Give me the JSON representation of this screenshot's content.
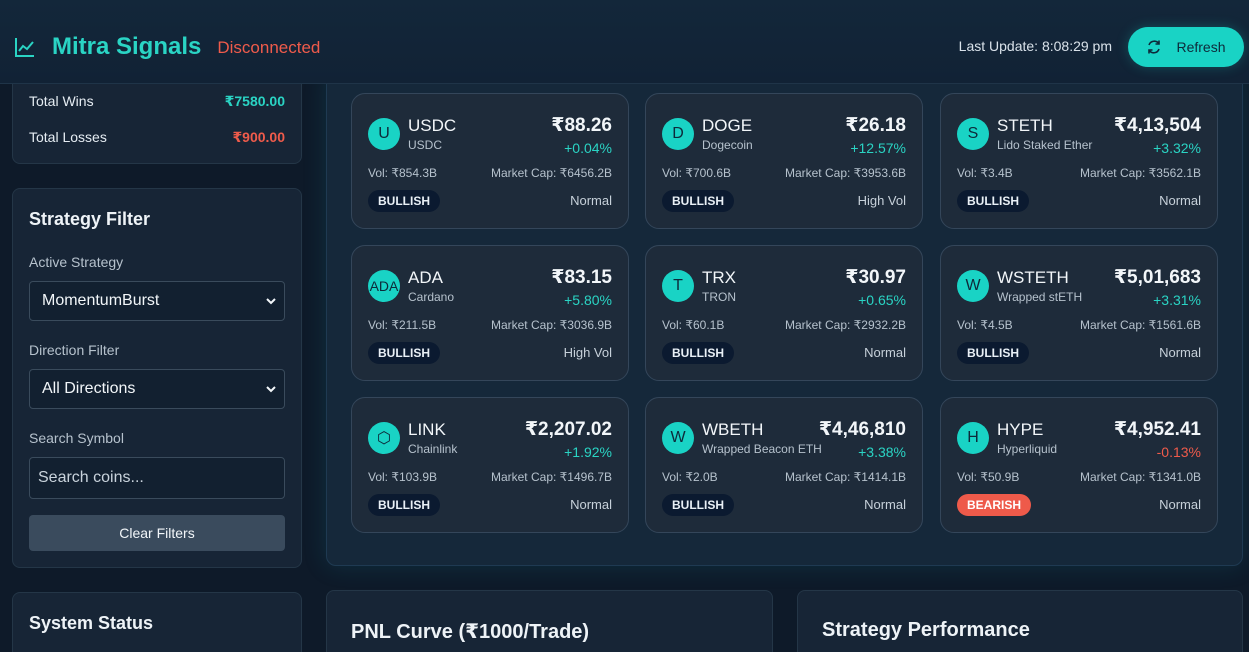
{
  "header": {
    "brand": "Mitra Signals",
    "connection_status": "Disconnected",
    "last_update": "Last Update: 8:08:29 pm",
    "refresh_label": "Refresh"
  },
  "stats": {
    "wins_label": "Total Wins",
    "wins_value": "₹7580.00",
    "losses_label": "Total Losses",
    "losses_value": "₹900.00"
  },
  "filter": {
    "title": "Strategy Filter",
    "strategy_label": "Active Strategy",
    "strategy_value": "MomentumBurst",
    "direction_label": "Direction Filter",
    "direction_value": "All Directions",
    "search_label": "Search Symbol",
    "search_placeholder": "Search coins...",
    "clear_label": "Clear Filters"
  },
  "system": {
    "title": "System Status"
  },
  "coins": [
    {
      "icon": "U",
      "symbol": "USDC",
      "name": "USDC",
      "price": "₹88.26",
      "change": "+0.04%",
      "dir": "up",
      "vol": "Vol: ₹854.3B",
      "mcap": "Market Cap: ₹6456.2B",
      "signal": "BULLISH",
      "volatility": "Normal"
    },
    {
      "icon": "D",
      "symbol": "DOGE",
      "name": "Dogecoin",
      "price": "₹26.18",
      "change": "+12.57%",
      "dir": "up",
      "vol": "Vol: ₹700.6B",
      "mcap": "Market Cap: ₹3953.6B",
      "signal": "BULLISH",
      "volatility": "High Vol"
    },
    {
      "icon": "S",
      "symbol": "STETH",
      "name": "Lido Staked Ether",
      "price": "₹4,13,504",
      "change": "+3.32%",
      "dir": "up",
      "vol": "Vol: ₹3.4B",
      "mcap": "Market Cap: ₹3562.1B",
      "signal": "BULLISH",
      "volatility": "Normal"
    },
    {
      "icon": "ADA",
      "symbol": "ADA",
      "name": "Cardano",
      "price": "₹83.15",
      "change": "+5.80%",
      "dir": "up",
      "vol": "Vol: ₹211.5B",
      "mcap": "Market Cap: ₹3036.9B",
      "signal": "BULLISH",
      "volatility": "High Vol"
    },
    {
      "icon": "T",
      "symbol": "TRX",
      "name": "TRON",
      "price": "₹30.97",
      "change": "+0.65%",
      "dir": "up",
      "vol": "Vol: ₹60.1B",
      "mcap": "Market Cap: ₹2932.2B",
      "signal": "BULLISH",
      "volatility": "Normal"
    },
    {
      "icon": "W",
      "symbol": "WSTETH",
      "name": "Wrapped stETH",
      "price": "₹5,01,683",
      "change": "+3.31%",
      "dir": "up",
      "vol": "Vol: ₹4.5B",
      "mcap": "Market Cap: ₹1561.6B",
      "signal": "BULLISH",
      "volatility": "Normal"
    },
    {
      "icon": "⬡",
      "symbol": "LINK",
      "name": "Chainlink",
      "price": "₹2,207.02",
      "change": "+1.92%",
      "dir": "up",
      "vol": "Vol: ₹103.9B",
      "mcap": "Market Cap: ₹1496.7B",
      "signal": "BULLISH",
      "volatility": "Normal"
    },
    {
      "icon": "W",
      "symbol": "WBETH",
      "name": "Wrapped Beacon ETH",
      "price": "₹4,46,810",
      "change": "+3.38%",
      "dir": "up",
      "vol": "Vol: ₹2.0B",
      "mcap": "Market Cap: ₹1414.1B",
      "signal": "BULLISH",
      "volatility": "Normal"
    },
    {
      "icon": "H",
      "symbol": "HYPE",
      "name": "Hyperliquid",
      "price": "₹4,952.41",
      "change": "-0.13%",
      "dir": "down",
      "vol": "Vol: ₹50.9B",
      "mcap": "Market Cap: ₹1341.0B",
      "signal": "BEARISH",
      "volatility": "Normal"
    }
  ],
  "bottom": {
    "pnl_title": "PNL Curve (₹1000/Trade)",
    "perf_title": "Strategy Performance"
  },
  "colors": {
    "accent": "#19d3c5",
    "negative": "#ef5b4b",
    "background": "#0e1a29"
  }
}
